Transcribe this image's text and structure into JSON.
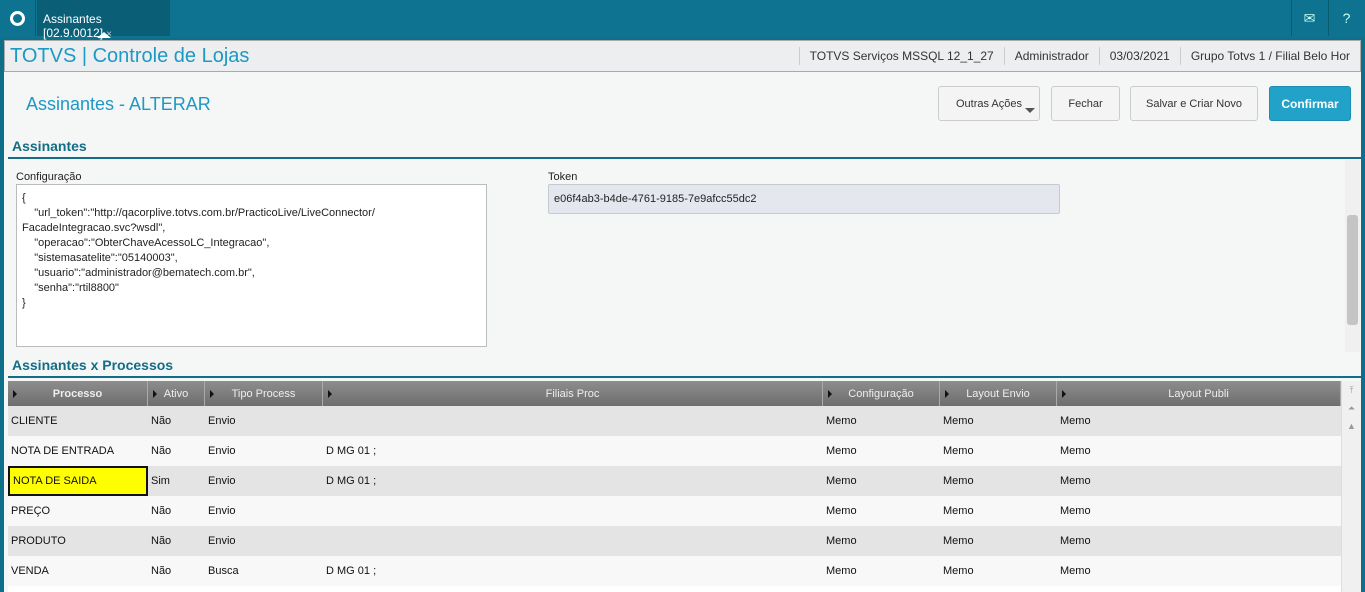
{
  "topbar": {
    "tab_label": "Assinantes [02.9.0012]",
    "tab_close": "×"
  },
  "header": {
    "title": "TOTVS | Controle de Lojas",
    "environment": "TOTVS Serviços MSSQL 12_1_27",
    "user": "Administrador",
    "date": "03/03/2021",
    "branch": "Grupo Totvs 1 / Filial Belo Hor"
  },
  "page": {
    "title": "Assinantes - ALTERAR",
    "buttons": {
      "other": "Outras Ações",
      "close": "Fechar",
      "save_new": "Salvar e Criar Novo",
      "confirm": "Confirmar"
    }
  },
  "form": {
    "section": "Assinantes",
    "config_label": "Configuração",
    "config_value": "{\n    \"url_token\":\"http://qacorplive.totvs.com.br/PracticoLive/LiveConnector/\nFacadeIntegracao.svc?wsdl\",\n    \"operacao\":\"ObterChaveAcessoLC_Integracao\",\n    \"sistemasatelite\":\"05140003\",\n    \"usuario\":\"administrador@bematech.com.br\",\n    \"senha\":\"rtil8800\"\n}",
    "token_label": "Token",
    "token_value": "e06f4ab3-b4de-4761-9185-7e9afcc55dc2"
  },
  "grid": {
    "section": "Assinantes x Processos",
    "columns": [
      "Processo",
      "Ativo",
      "Tipo Process",
      "Filiais Proc",
      "Configuração",
      "Layout Envio",
      "Layout Publi"
    ],
    "rows": [
      [
        "CLIENTE",
        "Não",
        "Envio",
        "",
        "Memo",
        "Memo",
        "Memo"
      ],
      [
        "NOTA DE ENTRADA",
        "Não",
        "Envio",
        "D MG 01 ;",
        "Memo",
        "Memo",
        "Memo"
      ],
      [
        "NOTA DE SAIDA",
        "Sim",
        "Envio",
        "D MG 01 ;",
        "Memo",
        "Memo",
        "Memo"
      ],
      [
        "PREÇO",
        "Não",
        "Envio",
        "",
        "Memo",
        "Memo",
        "Memo"
      ],
      [
        "PRODUTO",
        "Não",
        "Envio",
        "",
        "Memo",
        "Memo",
        "Memo"
      ],
      [
        "VENDA",
        "Não",
        "Busca",
        "D MG 01 ;",
        "Memo",
        "Memo",
        "Memo"
      ]
    ]
  }
}
